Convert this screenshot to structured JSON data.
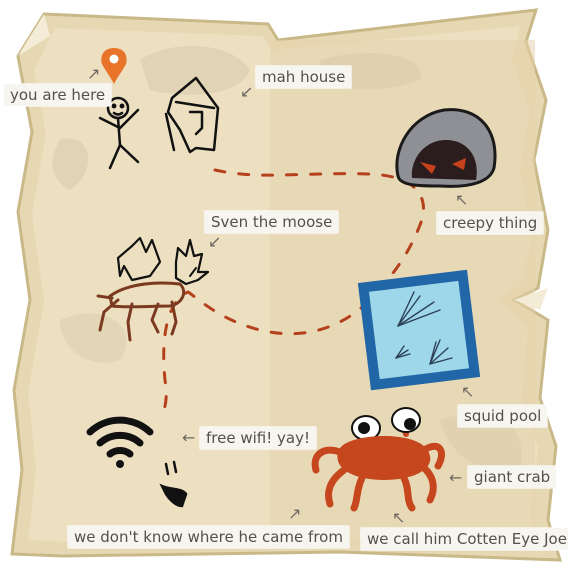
{
  "labels": {
    "you_are_here": "you are here",
    "mah_house": "mah house",
    "creepy_thing": "creepy thing",
    "sven": "Sven the moose",
    "squid_pool": "squid pool",
    "free_wifi": "free wifi! yay!",
    "giant_crab": "giant crab",
    "dont_know": "we don't know where he came from",
    "cotten_eye_joe": "we call him Cotten Eye Joe"
  },
  "icons": {
    "location_pin": "location-pin-icon",
    "stick_figure": "stick-figure",
    "house": "house-doodle",
    "creepy_thing": "hooded-creature",
    "moose": "moose-doodle",
    "squid_pool": "squid-pool",
    "wifi": "wifi-icon",
    "mystery_face": "mystery-face-doodle",
    "crab": "crab-doodle"
  },
  "colors": {
    "parchment": "#ece0c0",
    "parchment_edge": "#cdbd93",
    "trail": "#b5401c",
    "pin": "#e8742a",
    "pool_frame": "#2166a6",
    "pool_water": "#9fd7ea",
    "crab": "#c6461e",
    "moose": "#7b3a20",
    "creepy_gray": "#8f9095",
    "label_bg": "#f7f5f0",
    "label_text": "#555049"
  }
}
